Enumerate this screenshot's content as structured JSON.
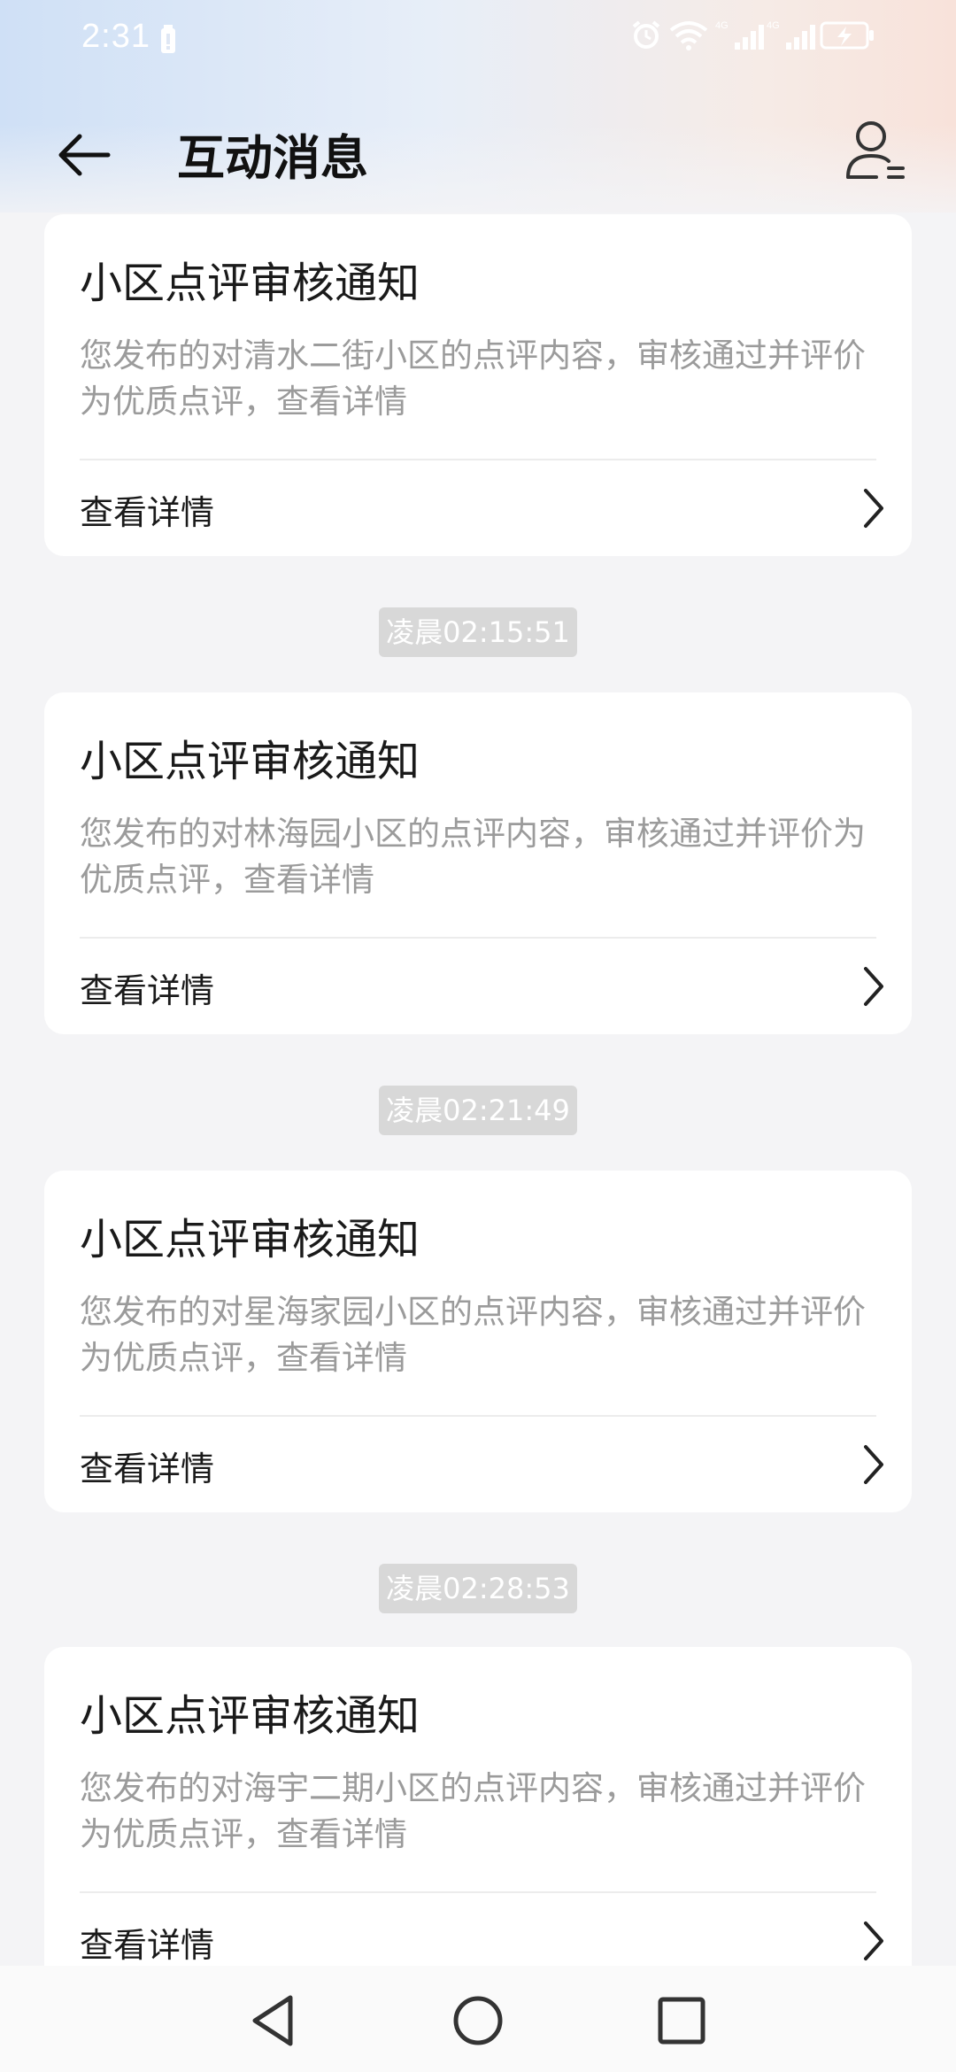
{
  "status_bar": {
    "time": "2:31"
  },
  "header": {
    "title": "互动消息"
  },
  "messages": [
    {
      "title": "小区点评审核通知",
      "body": "您发布的对清水二街小区的点评内容，审核通过并评价为优质点评，查看详情",
      "link_label": "查看详情"
    },
    {
      "timestamp": "凌晨02:15:51",
      "title": "小区点评审核通知",
      "body": "您发布的对林海园小区的点评内容，审核通过并评价为优质点评，查看详情",
      "link_label": "查看详情"
    },
    {
      "timestamp": "凌晨02:21:49",
      "title": "小区点评审核通知",
      "body": "您发布的对星海家园小区的点评内容，审核通过并评价为优质点评，查看详情",
      "link_label": "查看详情"
    },
    {
      "timestamp": "凌晨02:28:53",
      "title": "小区点评审核通知",
      "body": "您发布的对海宇二期小区的点评内容，审核通过并评价为优质点评，查看详情",
      "link_label": "查看详情"
    }
  ],
  "icons": {
    "back": "arrow-left-icon",
    "profile": "user-list-icon",
    "chevron": "chevron-right-icon",
    "nav_back": "triangle-back-icon",
    "nav_home": "circle-home-icon",
    "nav_recent": "square-recent-icon"
  },
  "colors": {
    "background": "#f4f4f6",
    "card": "#ffffff",
    "body_text": "#9b9b9b",
    "timestamp_bg": "#d8d8d8"
  }
}
